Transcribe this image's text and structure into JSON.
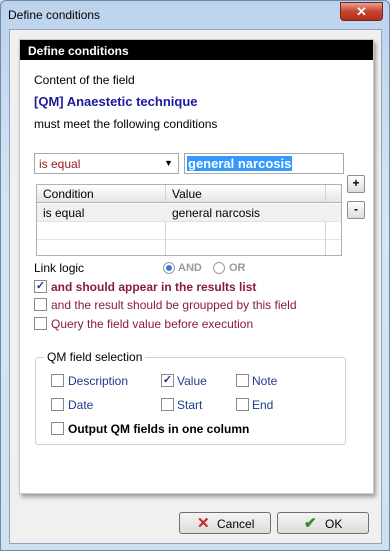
{
  "window": {
    "title": "Define conditions",
    "close_glyph": "✕"
  },
  "panel": {
    "header": "Define conditions",
    "intro": "Content of the field",
    "field_name": "[QM] Anaestetic technique",
    "must_meet": "must meet the following conditions"
  },
  "condition_select": {
    "value": "is equal",
    "arrow": "▼"
  },
  "value_input": {
    "value": "general narcosis"
  },
  "grid": {
    "headers": [
      "Condition",
      "Value"
    ],
    "rows": [
      {
        "condition": "is equal",
        "value": "general narcosis"
      }
    ]
  },
  "side_buttons": {
    "add": "+",
    "remove": "-"
  },
  "link_logic": {
    "label": "Link logic",
    "options": [
      {
        "label": "AND",
        "selected": true
      },
      {
        "label": "OR",
        "selected": false
      }
    ]
  },
  "options": [
    {
      "label": "and should appear in the results list",
      "checked": true,
      "bold": true
    },
    {
      "label": "and the result should be groupped by this field",
      "checked": false,
      "bold": false
    },
    {
      "label": "Query the field value before execution",
      "checked": false,
      "bold": false
    }
  ],
  "qm_field_selection": {
    "legend": "QM field selection",
    "fields": [
      {
        "label": "Description",
        "checked": false
      },
      {
        "label": "Value",
        "checked": true
      },
      {
        "label": "Note",
        "checked": false
      },
      {
        "label": "Date",
        "checked": false
      },
      {
        "label": "Start",
        "checked": false
      },
      {
        "label": "End",
        "checked": false
      }
    ],
    "one_column": {
      "label": "Output QM fields in one column",
      "checked": false
    }
  },
  "footer": {
    "cancel_label": "Cancel",
    "ok_label": "OK",
    "cancel_icon": "x-icon",
    "ok_icon": "check-icon"
  },
  "colors": {
    "field_name": "#1b1b9c",
    "option_text": "#8a1c3a",
    "selection": "#3399ff",
    "cancel_icon": "#c62828",
    "ok_icon": "#2e8b2e"
  }
}
